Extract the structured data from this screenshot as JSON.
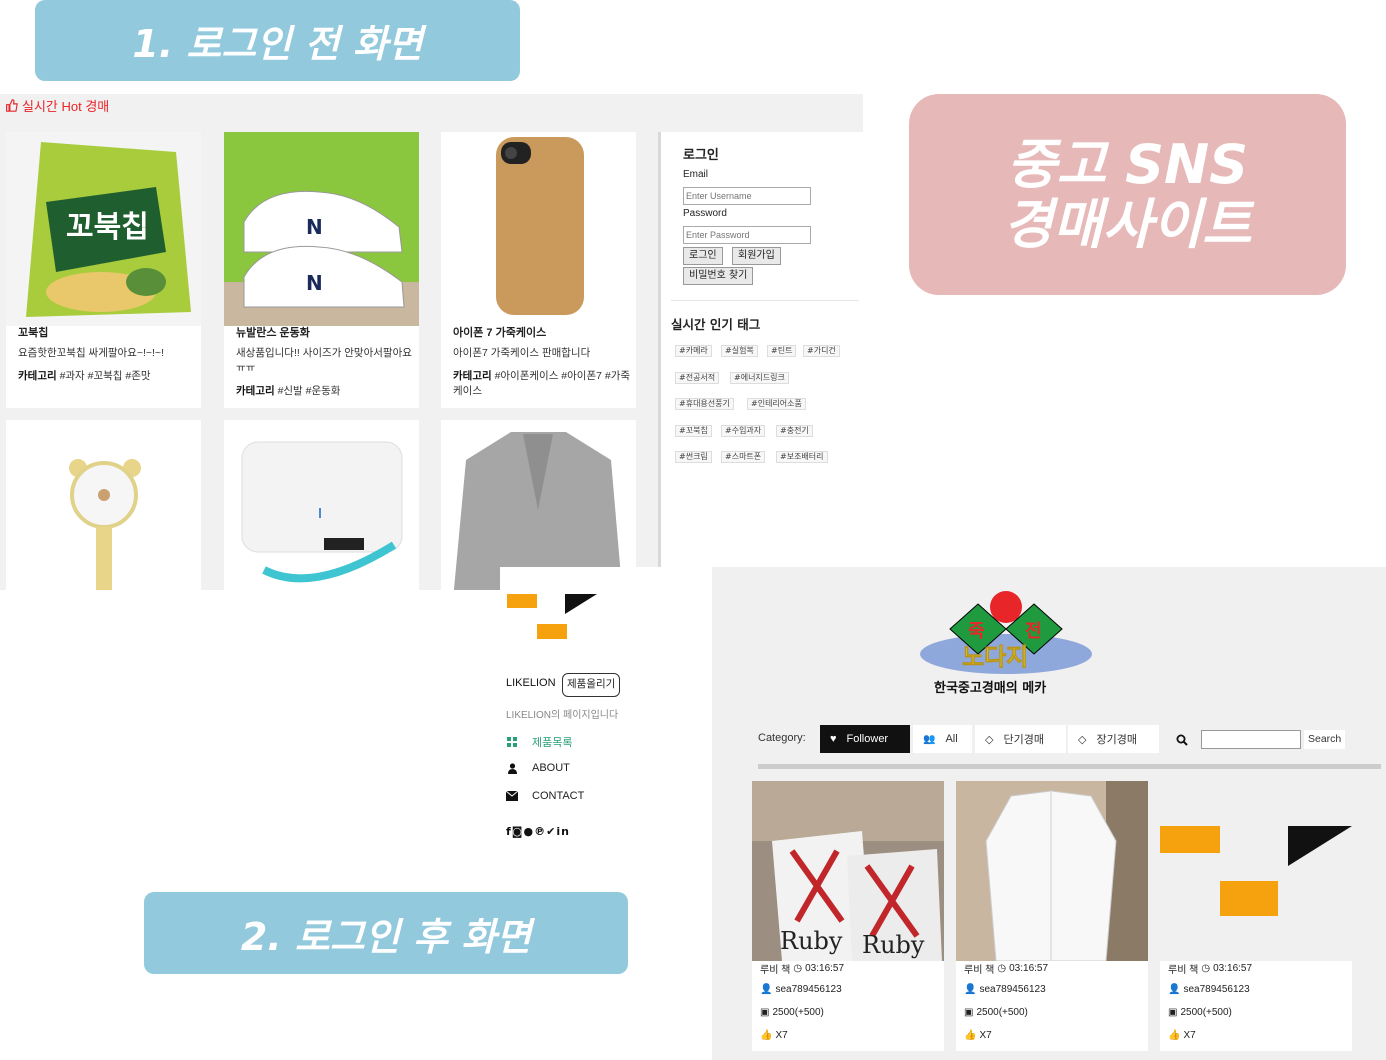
{
  "banners": {
    "before_login": "1. 로그인 전 화면",
    "site_title_line1": "중고 SNS",
    "site_title_line2": "경매사이트",
    "after_login": "2. 로그인 후 화면"
  },
  "screen1": {
    "hot_header": "실시간 Hot 경매",
    "cards": [
      {
        "title": "꼬북칩",
        "desc": "요즘핫한꼬북칩 싸게팔아요~!~!~!",
        "cat_label": "카테고리",
        "cat_tags": "#과자 #꼬북칩 #존맛"
      },
      {
        "title": "뉴발란스 운동화",
        "desc": "새상품입니다!! 사이즈가 안맞아서팔아요ㅠㅠ",
        "cat_label": "카테고리",
        "cat_tags": "#신발 #운동화"
      },
      {
        "title": "아이폰 7 가죽케이스",
        "desc": "아이폰7 가죽케이스 판매합니다",
        "cat_label": "카테고리",
        "cat_tags": "#아이폰케이스 #아이폰7 #가죽케이스"
      }
    ],
    "login": {
      "title": "로그인",
      "email_label": "Email",
      "email_placeholder": "Enter Username",
      "password_label": "Password",
      "password_placeholder": "Enter Password",
      "login_button": "로그인",
      "signup_button": "회원가입",
      "find_password_button": "비밀번호 찾기"
    },
    "popular_tags_title": "실시간 인기 태그",
    "tags": [
      "#카메라",
      "#실험복",
      "#틴트",
      "#가디건",
      "#전공서적",
      "#에너지드링크",
      "#휴대용선풍기",
      "#인테리어소품",
      "#꼬북칩",
      "#수입과자",
      "#충전기",
      "#썬크림",
      "#스마트폰",
      "#보조배터리"
    ]
  },
  "screen2_likelion": {
    "brand": "LIKELION",
    "upload_button": "제품올리기",
    "subtitle": "LIKELION의 페이지입니다",
    "nav": [
      {
        "label": "제품목록",
        "icon": "grid-icon",
        "active": true
      },
      {
        "label": "ABOUT",
        "icon": "user-icon",
        "active": false
      },
      {
        "label": "CONTACT",
        "icon": "envelope-icon",
        "active": false
      }
    ],
    "social_icons": [
      "facebook-icon",
      "instagram-icon",
      "github-icon",
      "pinterest-icon",
      "twitter-icon",
      "linkedin-icon"
    ]
  },
  "screen2_auction": {
    "logo_top_left": "죽",
    "logo_top_right": "전",
    "logo_mid": "노다지",
    "logo_caption": "한국중고경매의 메카",
    "category_label": "Category:",
    "tabs": [
      {
        "label": "Follower",
        "icon": "heart-icon",
        "active": true
      },
      {
        "label": "All",
        "icon": "users-icon",
        "active": false
      },
      {
        "label": "단기경매",
        "icon": "diamond-icon",
        "active": false
      },
      {
        "label": "장기경매",
        "icon": "diamond-icon",
        "active": false
      }
    ],
    "search_button": "Search",
    "products": [
      {
        "title": "루비 책",
        "time": "03:16:57",
        "seller": "sea789456123",
        "price": "2500(+500)",
        "likes": "X7"
      },
      {
        "title": "루비 책",
        "time": "03:16:57",
        "seller": "sea789456123",
        "price": "2500(+500)",
        "likes": "X7"
      },
      {
        "title": "루비 책",
        "time": "03:16:57",
        "seller": "sea789456123",
        "price": "2500(+500)",
        "likes": "X7"
      }
    ],
    "colors": {
      "active_tab": "#111111",
      "logo_orange": "#f5a20e"
    }
  }
}
